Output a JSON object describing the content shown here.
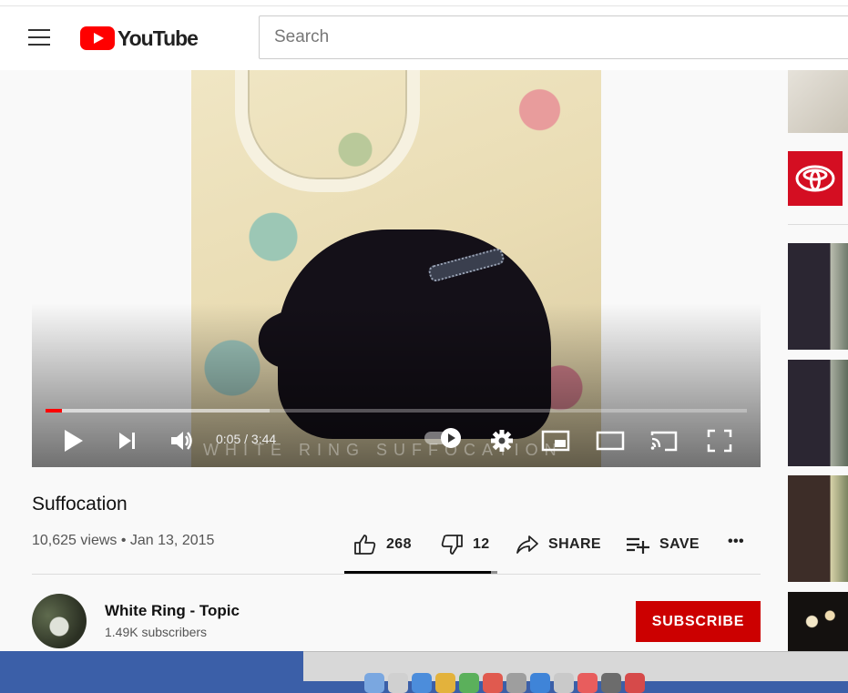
{
  "header": {
    "logo_text": "YouTube",
    "search_placeholder": "Search"
  },
  "player": {
    "time": "0:05 / 3:44",
    "progress_played_fraction": 0.023,
    "watermark": "WHITE RING    SUFFOCATION",
    "accent_color": "#ff0000"
  },
  "video": {
    "title": "Suffocation",
    "meta": "10,625 views • Jan 13, 2015",
    "likes": "268",
    "dislikes": "12",
    "share_label": "SHARE",
    "save_label": "SAVE",
    "more_label": "•••"
  },
  "channel": {
    "name": "White Ring - Topic",
    "subscribers": "1.49K subscribers",
    "subscribe_label": "SUBSCRIBE",
    "subscribe_color": "#cc0000"
  },
  "sidebar": {
    "ad_brand_icon": "toyota-logo-icon"
  }
}
